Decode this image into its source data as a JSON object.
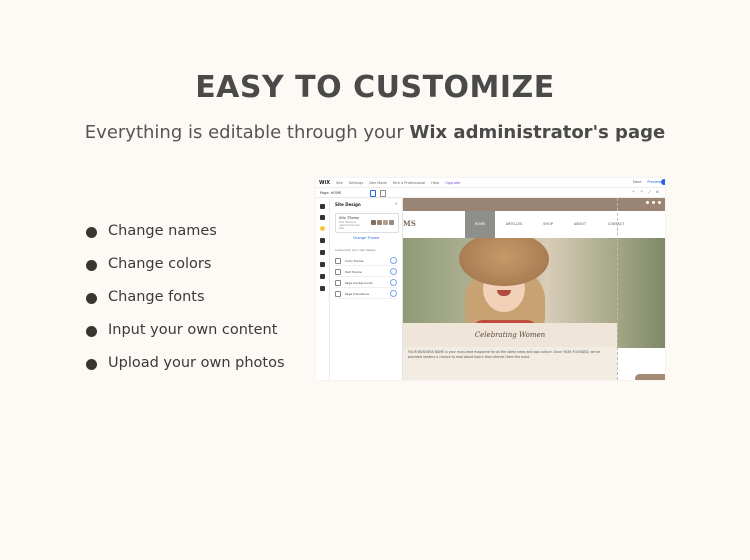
{
  "header": {
    "title": "EASY TO CUSTOMIZE",
    "subtitle_plain": "Everything is editable through your ",
    "subtitle_bold": "Wix administrator's page"
  },
  "features": [
    "Change names",
    "Change colors",
    "Change fonts",
    "Input your own content",
    "Upload your own photos"
  ],
  "editor": {
    "logo": "WiX",
    "menu": [
      "Site",
      "Settings",
      "Dev Mode",
      "Hire a Professional",
      "Help",
      "Upgrade"
    ],
    "right_menu": [
      "Save",
      "Preview"
    ],
    "page_selector": "Page: HOME",
    "panel": {
      "title": "Site Design",
      "theme_name": "Site Theme",
      "theme_desc": "This theme is used across your site",
      "change_theme": "Change Theme",
      "customize_label": "Customize your site design",
      "rows": [
        "Color theme",
        "Text theme",
        "Page backgrounds",
        "Page transitions"
      ],
      "swatches": [
        "#7d6e62",
        "#9a8474",
        "#b3a190",
        "#8e8e8a"
      ]
    },
    "site": {
      "brand": "MS",
      "nav": [
        "HOME",
        "ARTICLES",
        "SHOP",
        "ABOUT",
        "CONTACT"
      ],
      "hero_heading": "Celebrating Women",
      "body_text": "YOUR BUSINESS NAME is your must-read magazine for all the latest news and pop culture. Since YEAR FOUNDED, we've provided readers a chance to read about topics that interest them the most."
    }
  },
  "colors": {
    "background": "#fdfaf5",
    "bullet": "#3b3530",
    "accent_brown": "#9a8474",
    "wix_blue": "#2563eb"
  }
}
